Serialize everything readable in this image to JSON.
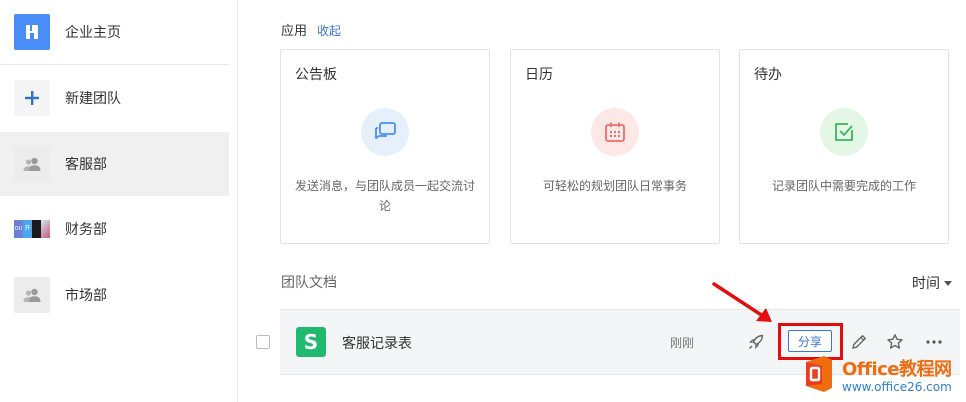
{
  "sidebar": {
    "items": [
      {
        "label": "企业主页",
        "icon": "building-icon"
      },
      {
        "label": "新建团队",
        "icon": "plus-icon"
      },
      {
        "label": "客服部",
        "icon": "team-icon"
      },
      {
        "label": "财务部",
        "icon": "photo-mosaic-avatar",
        "avatar_text": "开启"
      },
      {
        "label": "市场部",
        "icon": "team-icon"
      }
    ]
  },
  "apps": {
    "title": "应用",
    "collapse_label": "收起",
    "cards": [
      {
        "title": "公告板",
        "desc": "发送消息，与团队成员一起交流讨论",
        "icon": "chat-bubbles-icon",
        "color": "#4a8df6",
        "bg": "#e6f0fd"
      },
      {
        "title": "日历",
        "desc": "可轻松的规划团队日常事务",
        "icon": "calendar-icon",
        "color": "#ef6b6b",
        "bg": "#fde8e8"
      },
      {
        "title": "待办",
        "desc": "记录团队中需要完成的工作",
        "icon": "checkbox-icon",
        "color": "#3bb55a",
        "bg": "#e4f6e6"
      }
    ]
  },
  "docs": {
    "title": "团队文档",
    "sort_label": "时间",
    "rows": [
      {
        "name": "客服记录表",
        "time": "刚刚",
        "share_label": "分享",
        "file_icon_letter": "S"
      }
    ]
  },
  "watermark": {
    "line1": "Office教程网",
    "line2": "www.office26.com"
  },
  "colors": {
    "accent": "#3a76d8",
    "highlight": "#e40d0d",
    "sheet_green": "#1fba6e"
  }
}
